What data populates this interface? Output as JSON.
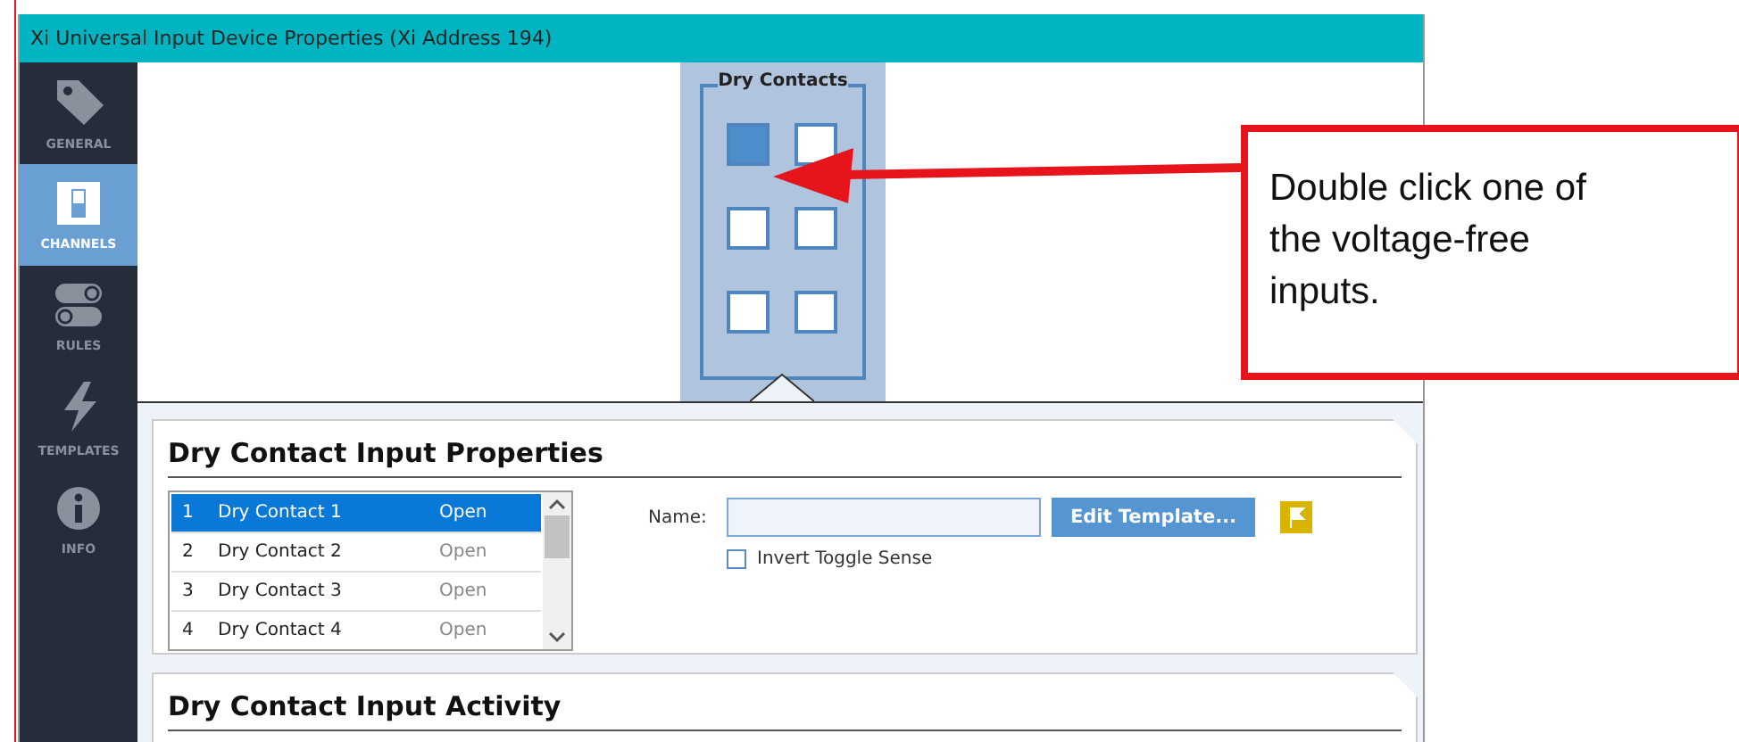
{
  "window": {
    "title": "Xi Universal Input Device Properties (Xi Address 194)"
  },
  "sidebar": {
    "items": [
      {
        "kind": "tag",
        "label": "GENERAL",
        "selected": false
      },
      {
        "kind": "switch",
        "label": "CHANNELS",
        "selected": true
      },
      {
        "kind": "toggles",
        "label": "RULES",
        "selected": false
      },
      {
        "kind": "bolt",
        "label": "TEMPLATES",
        "selected": false
      },
      {
        "kind": "info",
        "label": "INFO",
        "selected": false
      }
    ]
  },
  "dry_contacts": {
    "title": "Dry Contacts",
    "contacts": [
      {
        "selected": true
      },
      {
        "selected": false
      },
      {
        "selected": false
      },
      {
        "selected": false
      },
      {
        "selected": false
      },
      {
        "selected": false
      }
    ]
  },
  "properties": {
    "title": "Dry Contact Input Properties",
    "rows": [
      {
        "number": "1",
        "name": "Dry Contact 1",
        "state": "Open",
        "selected": true
      },
      {
        "number": "2",
        "name": "Dry Contact 2",
        "state": "Open",
        "selected": false
      },
      {
        "number": "3",
        "name": "Dry Contact 3",
        "state": "Open",
        "selected": false
      },
      {
        "number": "4",
        "name": "Dry Contact 4",
        "state": "Open",
        "selected": false
      }
    ],
    "name_label": "Name:",
    "edit_button": "Edit Template...",
    "invert": {
      "label": "Invert Toggle Sense",
      "checked": false
    }
  },
  "activity": {
    "title": "Dry Contact Input Activity"
  },
  "annotation": {
    "text": "Double click one of the voltage-free inputs."
  }
}
